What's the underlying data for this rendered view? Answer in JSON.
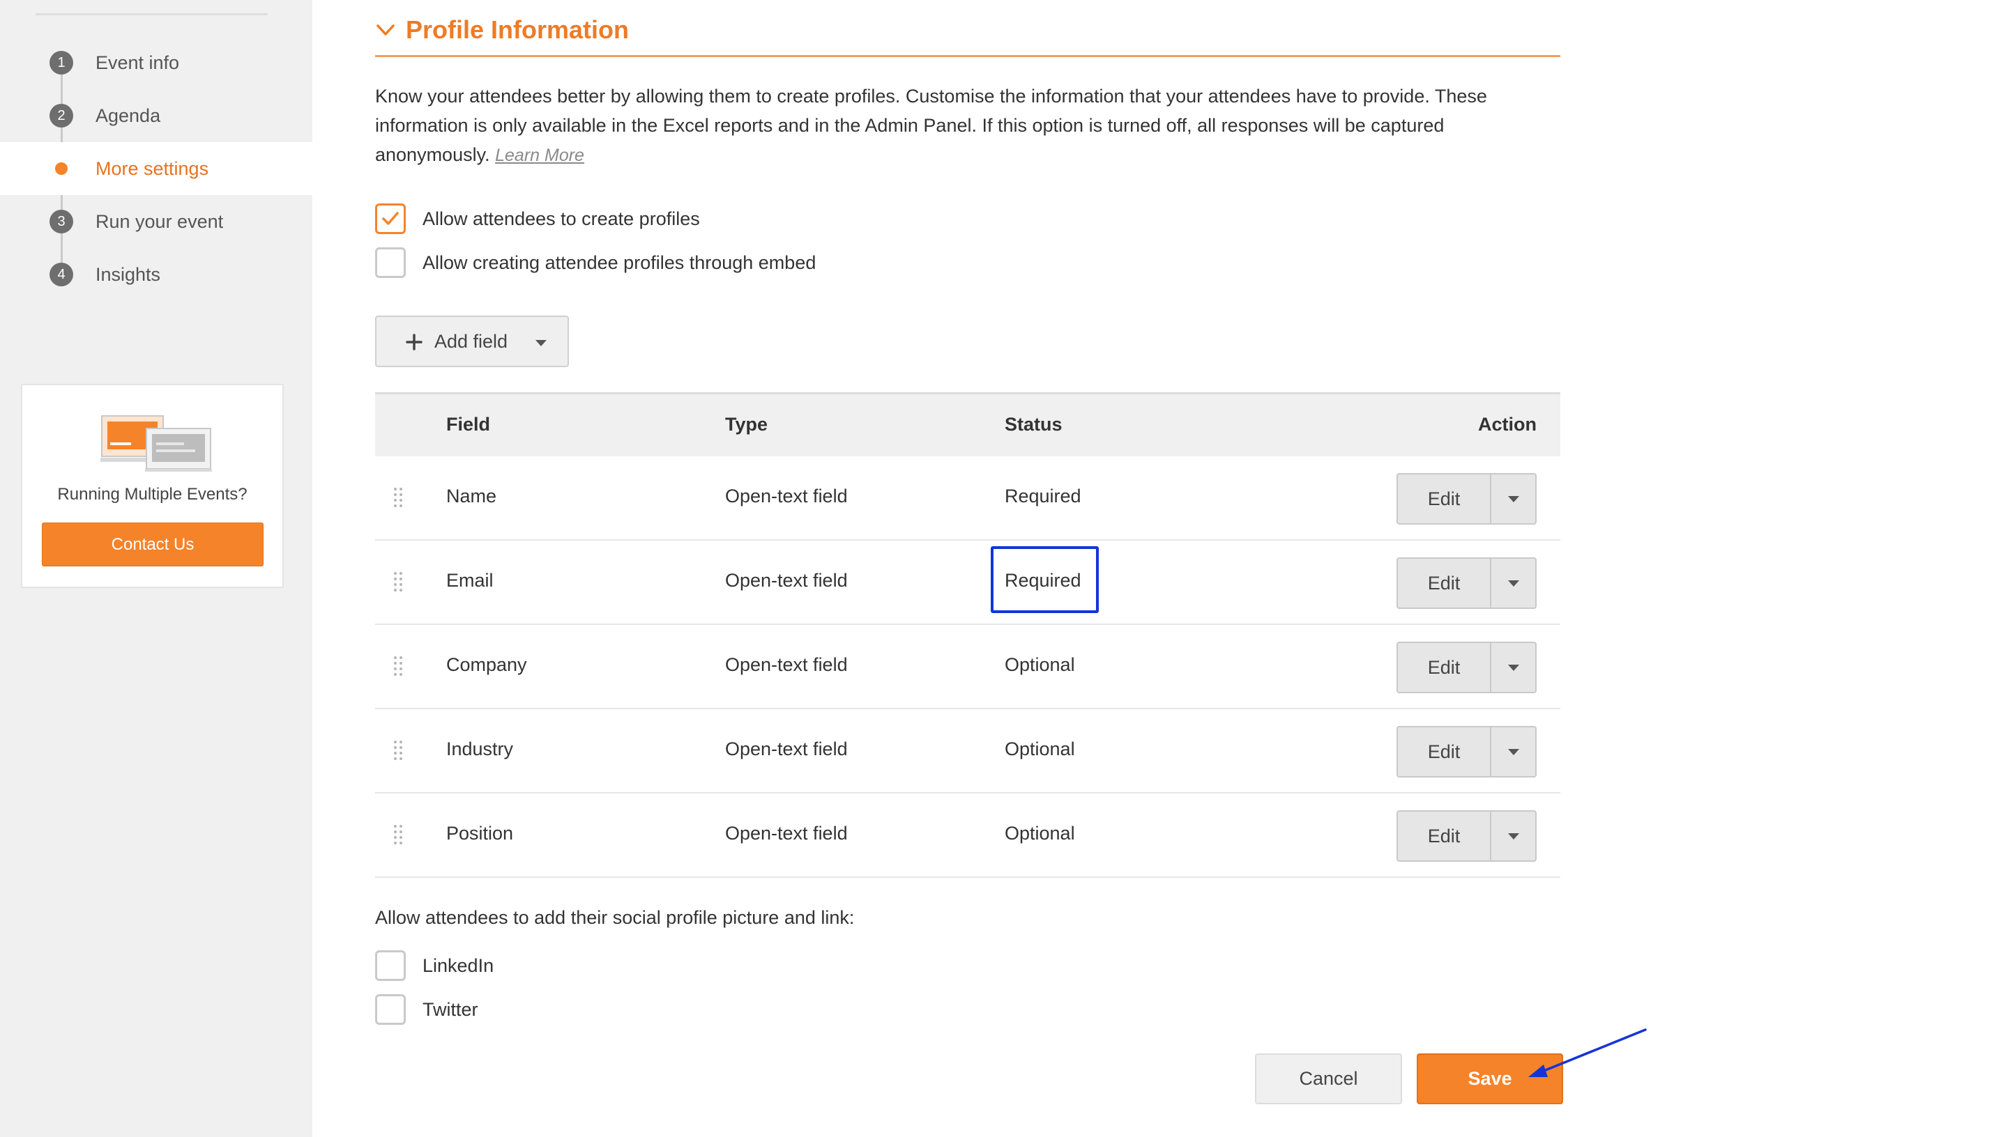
{
  "sidebar": {
    "steps": [
      {
        "num": "1",
        "label": "Event info",
        "active": false
      },
      {
        "num": "2",
        "label": "Agenda",
        "active": false
      },
      {
        "num": "",
        "label": "More settings",
        "active": true
      },
      {
        "num": "3",
        "label": "Run your event",
        "active": false
      },
      {
        "num": "4",
        "label": "Insights",
        "active": false
      }
    ],
    "promo": {
      "text": "Running Multiple Events?",
      "button": "Contact Us"
    }
  },
  "section": {
    "title": "Profile Information",
    "intro": "Know your attendees better by allowing them to create profiles. Customise the information that your attendees have to provide. These information is only available in the Excel reports and in the Admin Panel. If this option is turned off, all responses will be captured anonymously.",
    "learn_more": "Learn More"
  },
  "options": {
    "allow_profiles": {
      "label": "Allow attendees to create profiles",
      "checked": true
    },
    "allow_embed": {
      "label": "Allow creating attendee profiles through embed",
      "checked": false
    }
  },
  "add_field": {
    "label": "Add field",
    "icon": "plus-icon"
  },
  "table": {
    "headers": {
      "field": "Field",
      "type": "Type",
      "status": "Status",
      "action": "Action"
    },
    "rows": [
      {
        "field": "Name",
        "type": "Open-text field",
        "status": "Required",
        "action": "Edit"
      },
      {
        "field": "Email",
        "type": "Open-text field",
        "status": "Required",
        "action": "Edit"
      },
      {
        "field": "Company",
        "type": "Open-text field",
        "status": "Optional",
        "action": "Edit"
      },
      {
        "field": "Industry",
        "type": "Open-text field",
        "status": "Optional",
        "action": "Edit"
      },
      {
        "field": "Position",
        "type": "Open-text field",
        "status": "Optional",
        "action": "Edit"
      }
    ]
  },
  "social": {
    "label": "Allow attendees to add their social profile picture and link:",
    "linkedin": {
      "label": "LinkedIn",
      "checked": false
    },
    "twitter": {
      "label": "Twitter",
      "checked": false
    }
  },
  "footer": {
    "cancel": "Cancel",
    "save": "Save"
  },
  "colors": {
    "accent": "#f5832a",
    "annotation": "#1534d6"
  }
}
